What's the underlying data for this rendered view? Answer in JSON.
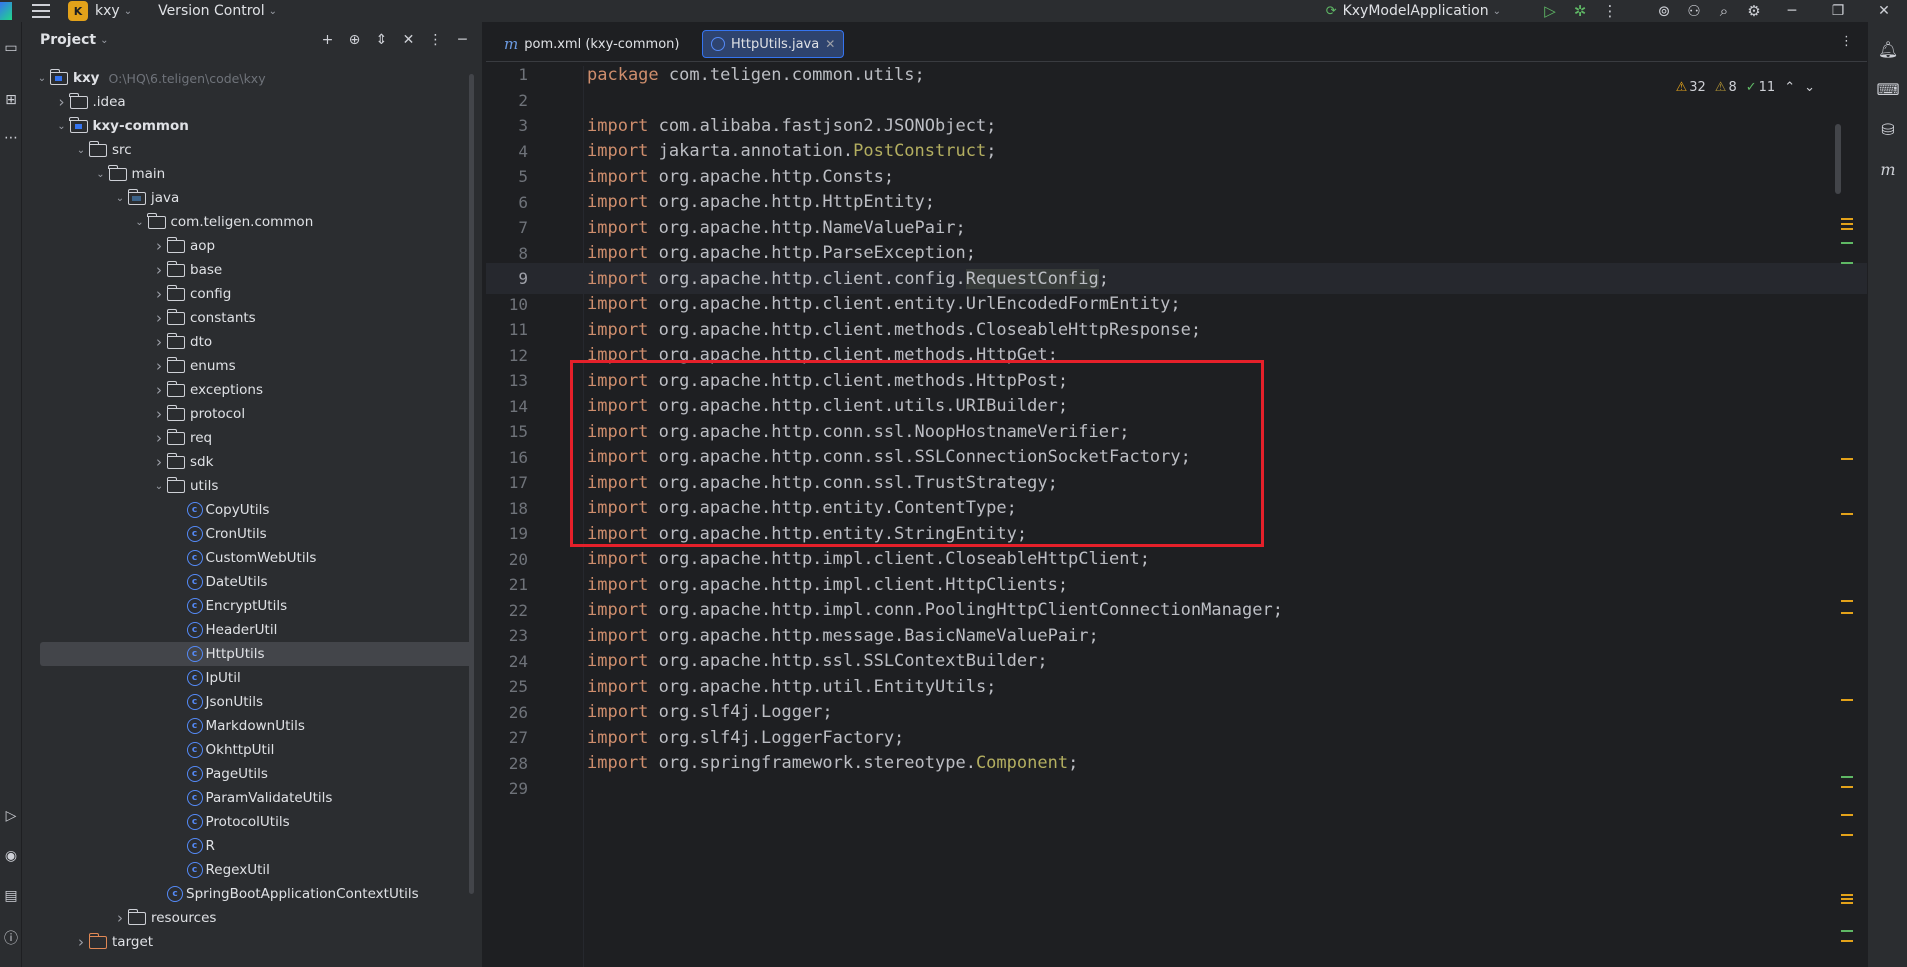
{
  "titlebar": {
    "project_badge": "K",
    "project_name": "kxy",
    "vcs_label": "Version Control",
    "run_config": "KxyModelApplication"
  },
  "project_panel": {
    "title": "Project",
    "tree": [
      {
        "label": "kxy",
        "path": "O:\\HQ\\6.teligen\\code\\kxy",
        "depth": 0,
        "arrow": "down",
        "icon": "module",
        "bold": true
      },
      {
        "label": ".idea",
        "depth": 1,
        "arrow": "right",
        "icon": "folder"
      },
      {
        "label": "kxy-common",
        "depth": 1,
        "arrow": "down",
        "icon": "module",
        "bold": true
      },
      {
        "label": "src",
        "depth": 2,
        "arrow": "down",
        "icon": "folder"
      },
      {
        "label": "main",
        "depth": 3,
        "arrow": "down",
        "icon": "folder"
      },
      {
        "label": "java",
        "depth": 4,
        "arrow": "down",
        "icon": "src"
      },
      {
        "label": "com.teligen.common",
        "depth": 5,
        "arrow": "down",
        "icon": "folder"
      },
      {
        "label": "aop",
        "depth": 6,
        "arrow": "right",
        "icon": "folder"
      },
      {
        "label": "base",
        "depth": 6,
        "arrow": "right",
        "icon": "folder"
      },
      {
        "label": "config",
        "depth": 6,
        "arrow": "right",
        "icon": "folder"
      },
      {
        "label": "constants",
        "depth": 6,
        "arrow": "right",
        "icon": "folder"
      },
      {
        "label": "dto",
        "depth": 6,
        "arrow": "right",
        "icon": "folder"
      },
      {
        "label": "enums",
        "depth": 6,
        "arrow": "right",
        "icon": "folder"
      },
      {
        "label": "exceptions",
        "depth": 6,
        "arrow": "right",
        "icon": "folder"
      },
      {
        "label": "protocol",
        "depth": 6,
        "arrow": "right",
        "icon": "folder"
      },
      {
        "label": "req",
        "depth": 6,
        "arrow": "right",
        "icon": "folder"
      },
      {
        "label": "sdk",
        "depth": 6,
        "arrow": "right",
        "icon": "folder"
      },
      {
        "label": "utils",
        "depth": 6,
        "arrow": "down",
        "icon": "folder"
      },
      {
        "label": "CopyUtils",
        "depth": 7,
        "icon": "class"
      },
      {
        "label": "CronUtils",
        "depth": 7,
        "icon": "class"
      },
      {
        "label": "CustomWebUtils",
        "depth": 7,
        "icon": "class"
      },
      {
        "label": "DateUtils",
        "depth": 7,
        "icon": "class"
      },
      {
        "label": "EncryptUtils",
        "depth": 7,
        "icon": "class"
      },
      {
        "label": "HeaderUtil",
        "depth": 7,
        "icon": "class"
      },
      {
        "label": "HttpUtils",
        "depth": 7,
        "icon": "class",
        "selected": true
      },
      {
        "label": "IpUtil",
        "depth": 7,
        "icon": "class"
      },
      {
        "label": "JsonUtils",
        "depth": 7,
        "icon": "class"
      },
      {
        "label": "MarkdownUtils",
        "depth": 7,
        "icon": "class"
      },
      {
        "label": "OkhttpUtil",
        "depth": 7,
        "icon": "class"
      },
      {
        "label": "PageUtils",
        "depth": 7,
        "icon": "class"
      },
      {
        "label": "ParamValidateUtils",
        "depth": 7,
        "icon": "class"
      },
      {
        "label": "ProtocolUtils",
        "depth": 7,
        "icon": "class"
      },
      {
        "label": "R",
        "depth": 7,
        "icon": "class"
      },
      {
        "label": "RegexUtil",
        "depth": 7,
        "icon": "class"
      },
      {
        "label": "SpringBootApplicationContextUtils",
        "depth": 6,
        "icon": "class"
      },
      {
        "label": "resources",
        "depth": 4,
        "arrow": "right",
        "icon": "folder"
      },
      {
        "label": "target",
        "depth": 2,
        "arrow": "right",
        "icon": "target"
      }
    ]
  },
  "editor": {
    "tabs": [
      {
        "label": "pom.xml (kxy-common)",
        "icon": "maven-icon",
        "active": false
      },
      {
        "label": "HttpUtils.java",
        "icon": "class-icon",
        "active": true
      }
    ],
    "inspections": {
      "warnings": "32",
      "weak_warnings": "8",
      "ok": "11"
    },
    "current_line": 9,
    "lines": [
      [
        [
          "kw",
          "package"
        ],
        [
          "t",
          " com.teligen.common.utils;"
        ]
      ],
      [],
      [
        [
          "kw",
          "import"
        ],
        [
          "t",
          " com.alibaba.fastjson2.JSONObject;"
        ]
      ],
      [
        [
          "kw",
          "import"
        ],
        [
          "t",
          " jakarta.annotation."
        ],
        [
          "ann",
          "PostConstruct"
        ],
        [
          "t",
          ";"
        ]
      ],
      [
        [
          "kw",
          "import"
        ],
        [
          "t",
          " org.apache.http.Consts;"
        ]
      ],
      [
        [
          "kw",
          "import"
        ],
        [
          "t",
          " org.apache.http.HttpEntity;"
        ]
      ],
      [
        [
          "kw",
          "import"
        ],
        [
          "t",
          " org.apache.http.NameValuePair;"
        ]
      ],
      [
        [
          "kw",
          "import"
        ],
        [
          "t",
          " org.apache.http.ParseException;"
        ]
      ],
      [
        [
          "kw",
          "import"
        ],
        [
          "t",
          " org.apache.http.client.config."
        ],
        [
          "hl",
          "RequestConfig"
        ],
        [
          "t",
          ";"
        ]
      ],
      [
        [
          "kw",
          "import"
        ],
        [
          "t",
          " org.apache.http.client.entity.UrlEncodedFormEntity;"
        ]
      ],
      [
        [
          "kw",
          "import"
        ],
        [
          "t",
          " org.apache.http.client.methods.CloseableHttpResponse;"
        ]
      ],
      [
        [
          "kw",
          "import"
        ],
        [
          "t",
          " org.apache.http.client.methods.HttpGet;"
        ]
      ],
      [
        [
          "kw",
          "import"
        ],
        [
          "t",
          " org.apache.http.client.methods.HttpPost;"
        ]
      ],
      [
        [
          "kw",
          "import"
        ],
        [
          "t",
          " org.apache.http.client.utils.URIBuilder;"
        ]
      ],
      [
        [
          "kw",
          "import"
        ],
        [
          "t",
          " org.apache.http.conn.ssl.NoopHostnameVerifier;"
        ]
      ],
      [
        [
          "kw",
          "import"
        ],
        [
          "t",
          " org.apache.http.conn.ssl.SSLConnectionSocketFactory;"
        ]
      ],
      [
        [
          "kw",
          "import"
        ],
        [
          "t",
          " org.apache.http.conn.ssl.TrustStrategy;"
        ]
      ],
      [
        [
          "kw",
          "import"
        ],
        [
          "t",
          " org.apache.http.entity.ContentType;"
        ]
      ],
      [
        [
          "kw",
          "import"
        ],
        [
          "t",
          " org.apache.http.entity.StringEntity;"
        ]
      ],
      [
        [
          "kw",
          "import"
        ],
        [
          "t",
          " org.apache.http.impl.client.CloseableHttpClient;"
        ]
      ],
      [
        [
          "kw",
          "import"
        ],
        [
          "t",
          " org.apache.http.impl.client.HttpClients;"
        ]
      ],
      [
        [
          "kw",
          "import"
        ],
        [
          "t",
          " org.apache.http.impl.conn.PoolingHttpClientConnectionManager;"
        ]
      ],
      [
        [
          "kw",
          "import"
        ],
        [
          "t",
          " org.apache.http.message.BasicNameValuePair;"
        ]
      ],
      [
        [
          "kw",
          "import"
        ],
        [
          "t",
          " org.apache.http.ssl.SSLContextBuilder;"
        ]
      ],
      [
        [
          "kw",
          "import"
        ],
        [
          "t",
          " org.apache.http.util.EntityUtils;"
        ]
      ],
      [
        [
          "kw",
          "import"
        ],
        [
          "t",
          " org.slf4j.Logger;"
        ]
      ],
      [
        [
          "kw",
          "import"
        ],
        [
          "t",
          " org.slf4j.LoggerFactory;"
        ]
      ],
      [
        [
          "kw",
          "import"
        ],
        [
          "t",
          " org.springframework.stereotype."
        ],
        [
          "ann",
          "Component"
        ],
        [
          "t",
          ";"
        ]
      ],
      []
    ]
  },
  "colors": {
    "keyword": "#cf8e6d",
    "annotation": "#b3ae60",
    "highlight_box": "#e5202a",
    "accent": "#3574f0"
  }
}
